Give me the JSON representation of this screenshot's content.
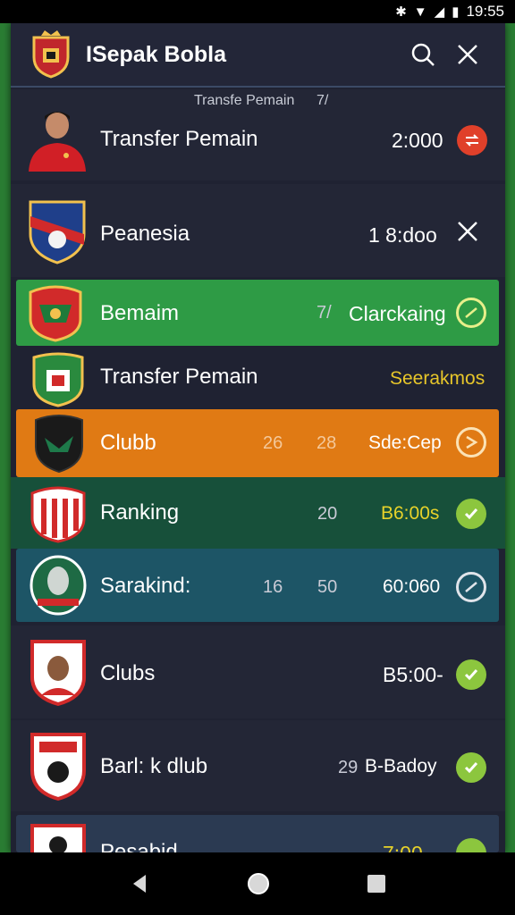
{
  "status_bar": {
    "time": "19:55"
  },
  "header": {
    "title": "ISepak Bobla"
  },
  "rows": [
    {
      "subtitle": "Transfe Pemain",
      "subtitle_extra": "7/",
      "name": "Transfer Pemain",
      "value": "2:000"
    },
    {
      "name": "Peanesia",
      "value": "1 8:doo"
    },
    {
      "name": "Bemaim",
      "num1": "7/",
      "value": "Clarckaing"
    },
    {
      "name": "Transfer Pemain",
      "value": "Seerakmos"
    },
    {
      "name": "Clubb",
      "num1": "26",
      "num2": "28",
      "value": "Sde:Cep"
    },
    {
      "name": "Ranking",
      "num2": "20",
      "value": "B6:00s"
    },
    {
      "name": "Sarakind:",
      "num1": "16",
      "num2": "50",
      "value": "60:060"
    },
    {
      "name": "Clubs",
      "value": "B5:00-"
    },
    {
      "name": "Barl: k dlub",
      "num2": "29",
      "value": "B-Badoy"
    },
    {
      "name": "Pesabid",
      "value": "7:00"
    }
  ],
  "colors": {
    "green": "#2e9b45",
    "orange": "#e07a14",
    "dark_green": "#17503a",
    "teal": "#1d5566",
    "panel": "#1f2232",
    "badge_green": "#8cc63e",
    "badge_red": "#e0402a"
  }
}
